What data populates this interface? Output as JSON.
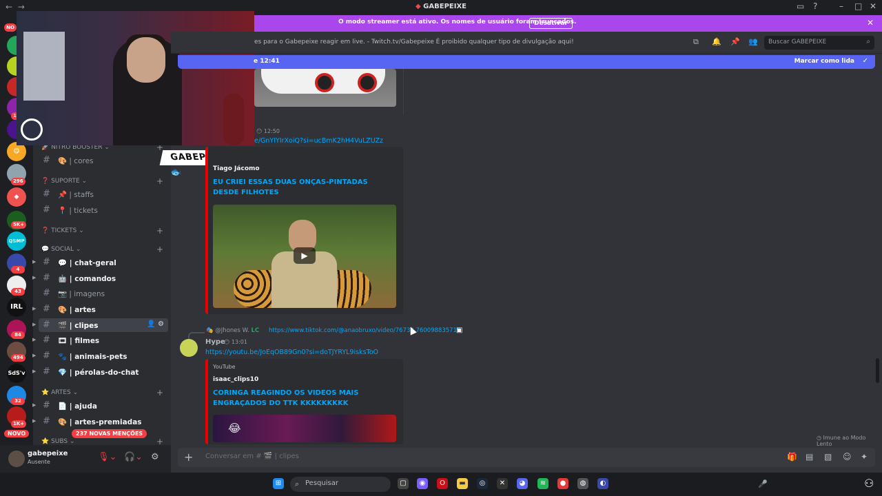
{
  "window": {
    "title": "GABEPEIXE",
    "back": "←",
    "forward": "→"
  },
  "streamer_bar": {
    "text": "O modo streamer está ativo. Os nomes de usuário foram truncados.",
    "button": "Desativar"
  },
  "guilds": {
    "novo_top": "NO",
    "novo_bottom": "NOVO",
    "badges": [
      "125",
      "296",
      "5K+",
      "4",
      "43",
      "84",
      "494",
      "32",
      "1K+"
    ],
    "labels": [
      "IRL",
      "SdS'v"
    ]
  },
  "sidebar": {
    "categories": {
      "nitro": "NITRO BOOSTER",
      "suporte": "SUPORTE",
      "tickets": "TICKETS",
      "social": "SOCIAL",
      "artes": "ARTES",
      "subs": "SUBS"
    },
    "channels": [
      {
        "emoji": "🎨",
        "name": "| cores"
      },
      {
        "emoji": "📌",
        "name": "| staffs"
      },
      {
        "emoji": "📍",
        "name": "| tickets"
      },
      {
        "emoji": "💬",
        "name": "| chat-geral"
      },
      {
        "emoji": "🤖",
        "name": "| comandos"
      },
      {
        "emoji": "📷",
        "name": "| imagens"
      },
      {
        "emoji": "🎨",
        "name": "| artes"
      },
      {
        "emoji": "🎬",
        "name": "| clipes"
      },
      {
        "emoji": "🎞",
        "name": "| filmes"
      },
      {
        "emoji": "🐾",
        "name": "| animais-pets"
      },
      {
        "emoji": "💎",
        "name": "| pérolas-do-chat"
      },
      {
        "emoji": "📄",
        "name": "| ajuda"
      },
      {
        "emoji": "🎨",
        "name": "| artes-premiadas"
      }
    ],
    "mentions": "237 NOVAS MENÇÕES"
  },
  "user": {
    "name": "gabepeixe",
    "status": "Ausente"
  },
  "overlay": {
    "logo_text": "GABEPEIXE"
  },
  "header": {
    "topic": "es para o Gabepeixe reagir em live. - Twitch.tv/Gabepeixe É proibido qualquer tipo de divulgação aqui!",
    "search_placeholder": "Buscar GABEPEIXE"
  },
  "new_messages": {
    "left": "e 12:41",
    "right": "Marcar como lida"
  },
  "messages": [
    {
      "time": "12:50",
      "link": "e/GnYIYIrXoiQ?si=ucBmK2hH4VuLZUZz",
      "embed_author": "Tiago Jácomo",
      "embed_title": "EU CRIEI ESSAS DUAS ONÇAS-PINTADAS DESDE FILHOTES"
    },
    {
      "reply_user": "@Jhones W.",
      "reply_tag": "LC",
      "reply_link": "https://www.tiktok.com/@anaobruxo/video/76732 760098835719",
      "author": "Hype",
      "time": "13:01",
      "link": "https://youtu.be/JoEqOB89Gn0?si=doTJYRYL9isksToO",
      "embed_provider": "YouTube",
      "embed_author": "isaac_clips10",
      "embed_title": "CORINGA REAGINDO OS VIDEOS MAIS ENGRAÇADOS DO TTK KKKKKKKKK"
    }
  ],
  "composer": {
    "placeholder": "Conversar em #",
    "channel": "| clipes"
  },
  "slowmode": "Imune ao Modo Lento",
  "taskbar": {
    "search": "Pesquisar"
  },
  "colors": {
    "streamer": "#a946ec",
    "blurple": "#5865f2",
    "link": "#00a8fc",
    "embed_accent": "#ff0000",
    "mention": "#f23f43"
  }
}
